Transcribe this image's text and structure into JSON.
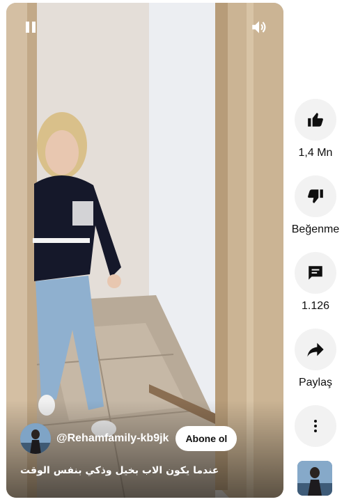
{
  "player": {
    "pause_icon": "pause-icon",
    "volume_icon": "volume-icon"
  },
  "channel": {
    "handle": "@Rehamfamily-kb9jk",
    "subscribe_label": "Abone ol"
  },
  "video": {
    "caption": "عندما يكون الاب بخيل وذكي بنفس الوقت"
  },
  "actions": {
    "like": {
      "icon": "thumbs-up-icon",
      "label": "1,4 Mn"
    },
    "dislike": {
      "icon": "thumbs-down-icon",
      "label": "Beğenme"
    },
    "comments": {
      "icon": "comment-icon",
      "label": "1.126"
    },
    "share": {
      "icon": "share-arrow-icon",
      "label": "Paylaş"
    },
    "more": {
      "icon": "more-vertical-icon"
    }
  },
  "colors": {
    "button_bg": "#f2f2f2",
    "text": "#0f0f0f",
    "subscribe_bg": "#ffffff"
  }
}
